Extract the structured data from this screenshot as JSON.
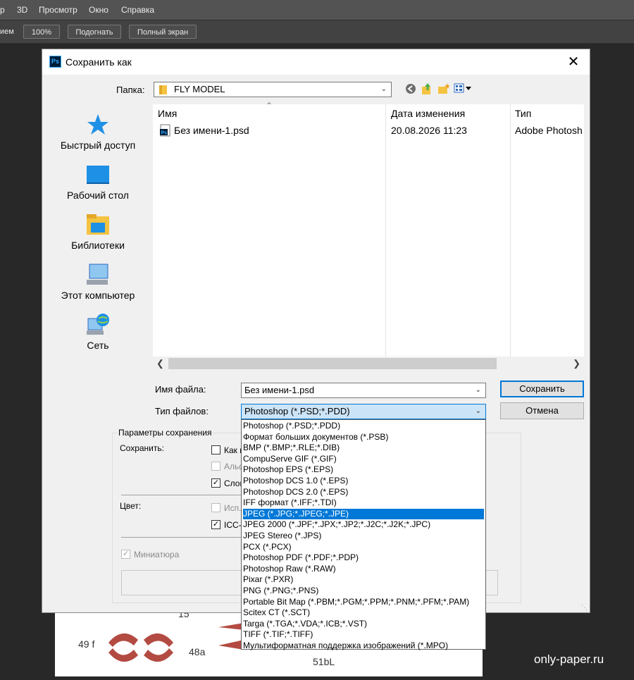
{
  "menubar": {
    "items": [
      "р",
      "3D",
      "Просмотр",
      "Окно",
      "Справка"
    ]
  },
  "options_bar": {
    "label": "ием",
    "zoom_button": "100%",
    "fit_button": "Подогнать",
    "fullscreen_button": "Полный экран"
  },
  "watermark": "only-paper.ru",
  "canvas_labels": {
    "l1": "15",
    "l2": "49 f",
    "l3": "48a",
    "l4": "51bL"
  },
  "dialog": {
    "title": "Сохранить как",
    "app_icon": "Ps",
    "close_icon": "✕",
    "folder_label": "Папка:",
    "folder_value": "FLY MODEL",
    "toolbar_icons": [
      "back-icon",
      "up-folder-icon",
      "new-folder-icon",
      "view-menu-icon"
    ],
    "places": [
      {
        "label": "Быстрый доступ",
        "icon": "star-icon"
      },
      {
        "label": "Рабочий стол",
        "icon": "desktop-icon"
      },
      {
        "label": "Библиотеки",
        "icon": "libraries-icon"
      },
      {
        "label": "Этот компьютер",
        "icon": "computer-icon"
      },
      {
        "label": "Сеть",
        "icon": "network-icon"
      }
    ],
    "columns": {
      "name": "Имя",
      "date": "Дата изменения",
      "type": "Тип"
    },
    "files": [
      {
        "name": "Без имени-1.psd",
        "date": "20.08.2026 11:23",
        "type": "Adobe Photosh"
      }
    ],
    "filename_label": "Имя файла:",
    "filename_value": "Без имени-1.psd",
    "filetype_label": "Тип файлов:",
    "filetype_value": "Photoshop (*.PSD;*.PDD)",
    "save_button": "Сохранить",
    "cancel_button": "Отмена",
    "params": {
      "group_title": "Параметры сохранения",
      "save_label": "Сохранить:",
      "as_copy": "Как к",
      "alpha": "Альф",
      "layers": "Слои",
      "color_label": "Цвет:",
      "use_proof": "Исп.",
      "icc": "ICC-п",
      "thumbnail": "Миниатюра"
    }
  },
  "filetype_options": [
    "Photoshop (*.PSD;*.PDD)",
    "Формат больших документов (*.PSB)",
    "BMP (*.BMP;*.RLE;*.DIB)",
    "CompuServe GIF (*.GIF)",
    "Photoshop EPS (*.EPS)",
    "Photoshop DCS 1.0 (*.EPS)",
    "Photoshop DCS 2.0 (*.EPS)",
    "IFF формат (*.IFF;*.TDI)",
    "JPEG (*.JPG;*.JPEG;*.JPE)",
    "JPEG 2000 (*.JPF;*.JPX;*.JP2;*.J2C;*.J2K;*.JPC)",
    "JPEG Stereo (*.JPS)",
    "PCX (*.PCX)",
    "Photoshop PDF (*.PDF;*.PDP)",
    "Photoshop Raw (*.RAW)",
    "Pixar (*.PXR)",
    "PNG (*.PNG;*.PNS)",
    "Portable Bit Map (*.PBM;*.PGM;*.PPM;*.PNM;*.PFM;*.PAM)",
    "Scitex CT (*.SCT)",
    "Targa (*.TGA;*.VDA;*.ICB;*.VST)",
    "TIFF (*.TIF;*.TIFF)",
    "Мультиформатная поддержка изображений  (*.MPO)"
  ],
  "selected_option_index": 8
}
